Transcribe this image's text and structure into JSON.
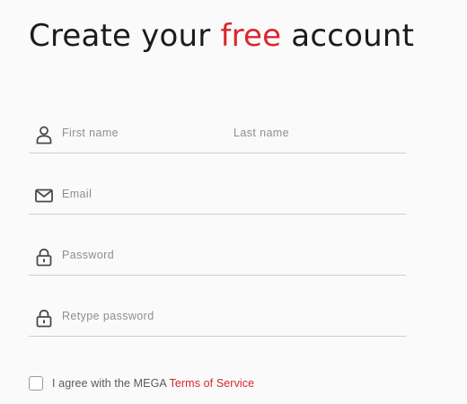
{
  "heading": {
    "part1": "Create your ",
    "accent": "free",
    "part2": " account"
  },
  "form": {
    "first_name": {
      "placeholder": "First name",
      "value": ""
    },
    "last_name": {
      "placeholder": "Last name",
      "value": ""
    },
    "email": {
      "placeholder": "Email",
      "value": ""
    },
    "password": {
      "placeholder": "Password",
      "value": ""
    },
    "retype_password": {
      "placeholder": "Retype password",
      "value": ""
    }
  },
  "agreement": {
    "checked": false,
    "text": "I agree with the MEGA ",
    "link": "Terms of Service"
  },
  "icons": {
    "name": "user-icon",
    "email": "envelope-icon",
    "password": "lock-icon",
    "retype": "lock-icon"
  },
  "colors": {
    "accent": "#d9272e",
    "text": "#1b1b1b",
    "border": "#cfcfcf",
    "placeholder": "#8e8e8e"
  }
}
